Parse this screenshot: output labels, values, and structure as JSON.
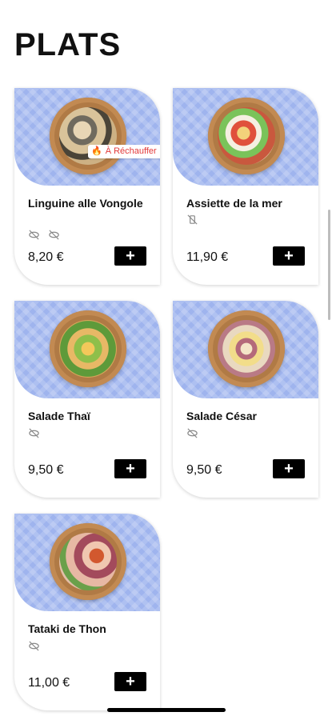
{
  "page": {
    "title": "PLATS"
  },
  "colors": {
    "card_bg": "#9fb4ee",
    "button": "#000000",
    "badge_text": "#e23a3a"
  },
  "dishes": [
    {
      "name": "Linguine alle Vongole",
      "price": "8,20 €",
      "badge": "À Réchauffer",
      "icons": [
        "no-gluten-icon",
        "no-gluten-icon"
      ]
    },
    {
      "name": "Assiette de la mer",
      "price": "11,90 €",
      "icons": [
        "no-lactose-icon"
      ]
    },
    {
      "name": "Salade Thaï",
      "price": "9,50 €",
      "icons": [
        "no-gluten-icon"
      ]
    },
    {
      "name": "Salade César",
      "price": "9,50 €",
      "icons": [
        "no-gluten-icon"
      ]
    },
    {
      "name": "Tataki de Thon",
      "price": "11,00 €",
      "icons": [
        "no-gluten-icon"
      ]
    }
  ],
  "add_button": {
    "label": "+"
  }
}
